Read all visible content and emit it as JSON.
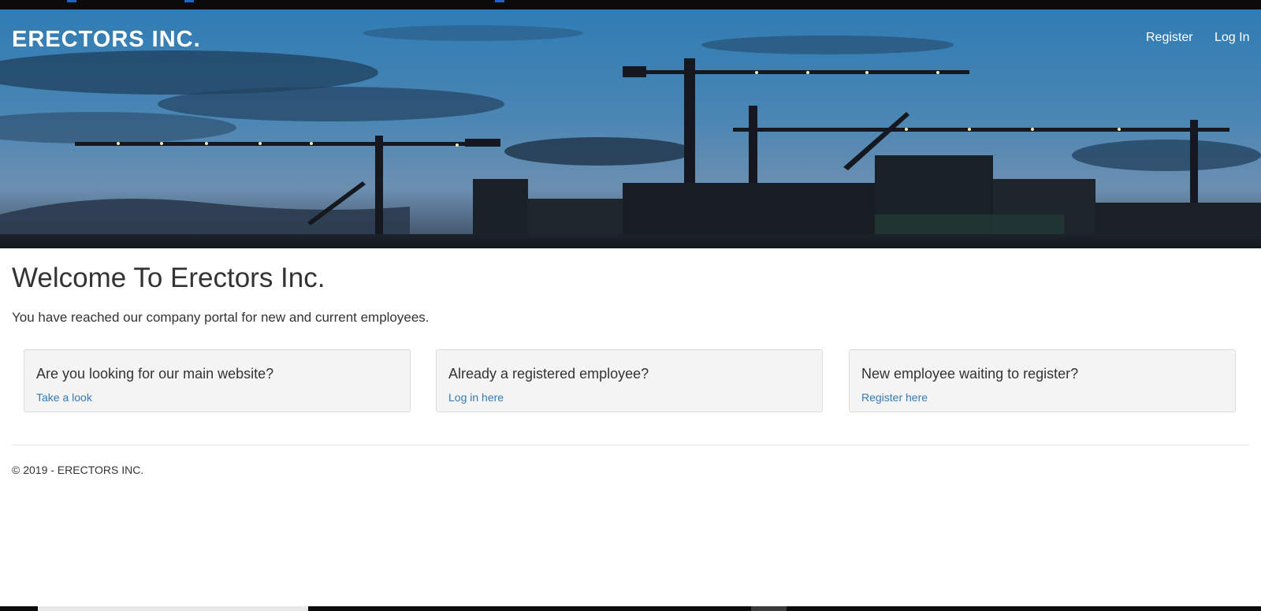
{
  "header": {
    "brand": "ERECTORS INC.",
    "nav": {
      "register": "Register",
      "login": "Log In"
    }
  },
  "hero": {
    "image": "construction-cranes-dusk-skyline"
  },
  "main": {
    "title": "Welcome To Erectors Inc.",
    "subtitle": "You have reached our company portal for new and current employees.",
    "cards": [
      {
        "title": "Are you looking for our main website?",
        "link": "Take a look"
      },
      {
        "title": "Already a registered employee?",
        "link": "Log in here"
      },
      {
        "title": "New employee waiting to register?",
        "link": "Register here"
      }
    ]
  },
  "footer": {
    "copyright": "© 2019 - ERECTORS INC."
  },
  "colors": {
    "link": "#337ab7",
    "card_bg": "#f4f4f4",
    "text": "#333333"
  }
}
